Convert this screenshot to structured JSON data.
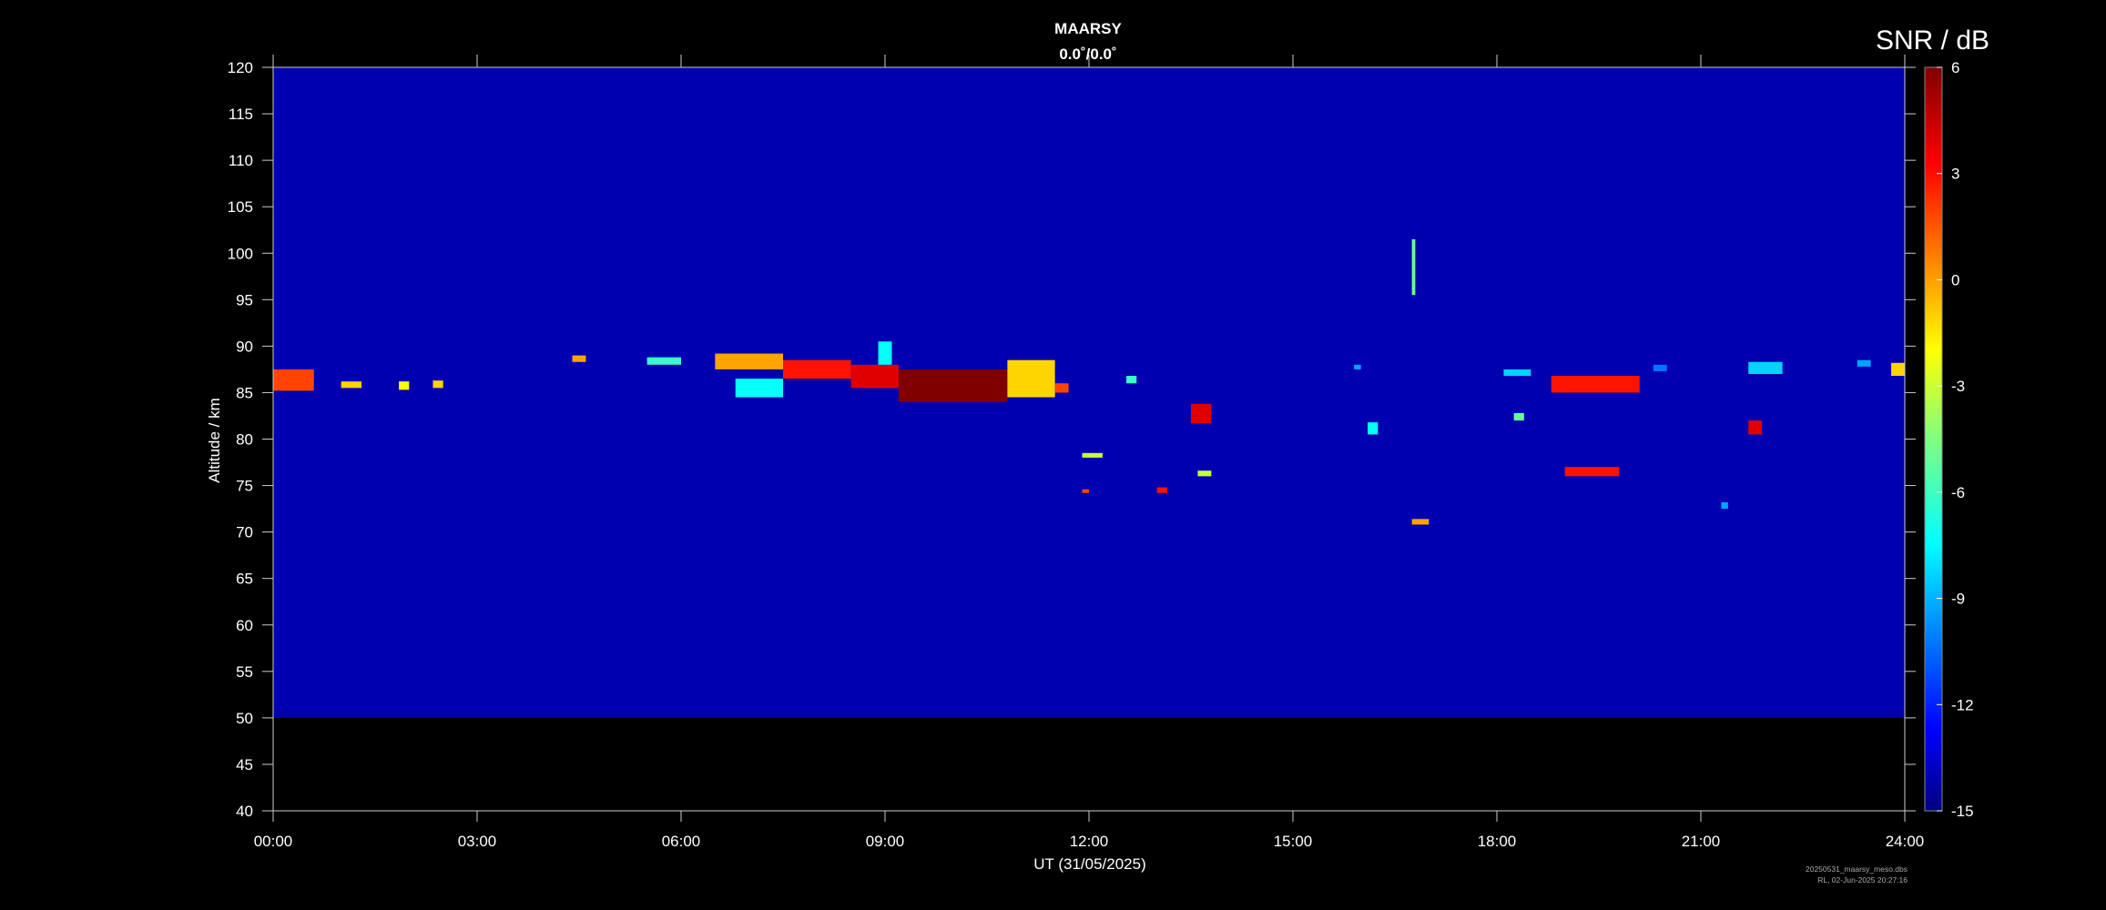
{
  "chart_data": {
    "type": "heatmap",
    "title": "MAARSY",
    "subtitle": "0.0˚/0.0˚",
    "xlabel": "UT (31/05/2025)",
    "ylabel": "Altitude / km",
    "x_ticks": [
      "00:00",
      "03:00",
      "06:00",
      "09:00",
      "12:00",
      "15:00",
      "18:00",
      "21:00",
      "24:00"
    ],
    "x_range_hours": [
      0,
      24
    ],
    "y_ticks": [
      40,
      45,
      50,
      55,
      60,
      65,
      70,
      75,
      80,
      85,
      90,
      95,
      100,
      105,
      110,
      115,
      120
    ],
    "ylim": [
      40,
      120
    ],
    "data_altitude_range_km": [
      50,
      120
    ],
    "colorbar": {
      "label": "SNR / dB",
      "range": [
        -15,
        6
      ],
      "ticks": [
        6,
        3,
        0,
        -3,
        -6,
        -9,
        -12,
        -15
      ],
      "colormap": "jet"
    },
    "background_snr_db": -14,
    "echo_regions": [
      {
        "t_start": 0.0,
        "t_end": 0.6,
        "alt_low": 85.2,
        "alt_high": 87.5,
        "snr_db": 2
      },
      {
        "t_start": 1.0,
        "t_end": 1.3,
        "alt_low": 85.5,
        "alt_high": 86.2,
        "snr_db": -1
      },
      {
        "t_start": 1.85,
        "t_end": 2.0,
        "alt_low": 85.3,
        "alt_high": 86.2,
        "snr_db": -2
      },
      {
        "t_start": 2.35,
        "t_end": 2.5,
        "alt_low": 85.5,
        "alt_high": 86.3,
        "snr_db": -1
      },
      {
        "t_start": 4.4,
        "t_end": 4.6,
        "alt_low": 88.3,
        "alt_high": 89.0,
        "snr_db": 0
      },
      {
        "t_start": 5.5,
        "t_end": 6.0,
        "alt_low": 88.0,
        "alt_high": 88.8,
        "snr_db": -6
      },
      {
        "t_start": 6.5,
        "t_end": 7.5,
        "alt_low": 87.5,
        "alt_high": 89.2,
        "snr_db": 0
      },
      {
        "t_start": 6.8,
        "t_end": 7.5,
        "alt_low": 84.5,
        "alt_high": 86.5,
        "snr_db": -7
      },
      {
        "t_start": 7.5,
        "t_end": 8.5,
        "alt_low": 86.5,
        "alt_high": 88.5,
        "snr_db": 3
      },
      {
        "t_start": 8.5,
        "t_end": 9.2,
        "alt_low": 85.5,
        "alt_high": 88.0,
        "snr_db": 4
      },
      {
        "t_start": 8.9,
        "t_end": 9.1,
        "alt_low": 88.0,
        "alt_high": 90.5,
        "snr_db": -7
      },
      {
        "t_start": 9.2,
        "t_end": 10.8,
        "alt_low": 84.0,
        "alt_high": 87.5,
        "snr_db": 6
      },
      {
        "t_start": 10.8,
        "t_end": 11.5,
        "alt_low": 84.5,
        "alt_high": 88.5,
        "snr_db": -1
      },
      {
        "t_start": 11.5,
        "t_end": 11.7,
        "alt_low": 85.0,
        "alt_high": 86.0,
        "snr_db": 2
      },
      {
        "t_start": 12.55,
        "t_end": 12.7,
        "alt_low": 86.0,
        "alt_high": 86.8,
        "snr_db": -6
      },
      {
        "t_start": 11.9,
        "t_end": 12.2,
        "alt_low": 78.0,
        "alt_high": 78.5,
        "snr_db": -3
      },
      {
        "t_start": 11.9,
        "t_end": 12.0,
        "alt_low": 74.2,
        "alt_high": 74.6,
        "snr_db": 2
      },
      {
        "t_start": 13.0,
        "t_end": 13.15,
        "alt_low": 74.2,
        "alt_high": 74.8,
        "snr_db": 3
      },
      {
        "t_start": 13.5,
        "t_end": 13.8,
        "alt_low": 81.7,
        "alt_high": 83.8,
        "snr_db": 4
      },
      {
        "t_start": 13.6,
        "t_end": 13.8,
        "alt_low": 76.0,
        "alt_high": 76.6,
        "snr_db": -3
      },
      {
        "t_start": 15.9,
        "t_end": 16.0,
        "alt_low": 87.5,
        "alt_high": 88.0,
        "snr_db": -9
      },
      {
        "t_start": 16.1,
        "t_end": 16.25,
        "alt_low": 80.5,
        "alt_high": 81.8,
        "snr_db": -7
      },
      {
        "t_start": 16.75,
        "t_end": 17.0,
        "alt_low": 70.8,
        "alt_high": 71.4,
        "snr_db": 0
      },
      {
        "t_start": 18.1,
        "t_end": 18.5,
        "alt_low": 86.8,
        "alt_high": 87.5,
        "snr_db": -8
      },
      {
        "t_start": 18.25,
        "t_end": 18.4,
        "alt_low": 82.0,
        "alt_high": 82.8,
        "snr_db": -5
      },
      {
        "t_start": 18.8,
        "t_end": 20.1,
        "alt_low": 85.0,
        "alt_high": 86.8,
        "snr_db": 3
      },
      {
        "t_start": 19.0,
        "t_end": 19.8,
        "alt_low": 76.0,
        "alt_high": 77.0,
        "snr_db": 3
      },
      {
        "t_start": 20.3,
        "t_end": 20.5,
        "alt_low": 87.3,
        "alt_high": 88.0,
        "snr_db": -10
      },
      {
        "t_start": 21.3,
        "t_end": 21.4,
        "alt_low": 72.5,
        "alt_high": 73.2,
        "snr_db": -9
      },
      {
        "t_start": 21.7,
        "t_end": 21.9,
        "alt_low": 80.5,
        "alt_high": 82.0,
        "snr_db": 4
      },
      {
        "t_start": 21.7,
        "t_end": 22.2,
        "alt_low": 87.0,
        "alt_high": 88.3,
        "snr_db": -8
      },
      {
        "t_start": 23.3,
        "t_end": 23.5,
        "alt_low": 87.8,
        "alt_high": 88.5,
        "snr_db": -9
      },
      {
        "t_start": 23.8,
        "t_end": 24.0,
        "alt_low": 86.8,
        "alt_high": 88.2,
        "snr_db": -1
      },
      {
        "t_start": 16.75,
        "t_end": 16.8,
        "alt_low": 95.5,
        "alt_high": 101.5,
        "snr_db": -5
      }
    ]
  },
  "footer": {
    "file": "20250531_maarsy_meso.dbs",
    "stamp": "RL, 02-Jun-2025 20:27:16"
  }
}
